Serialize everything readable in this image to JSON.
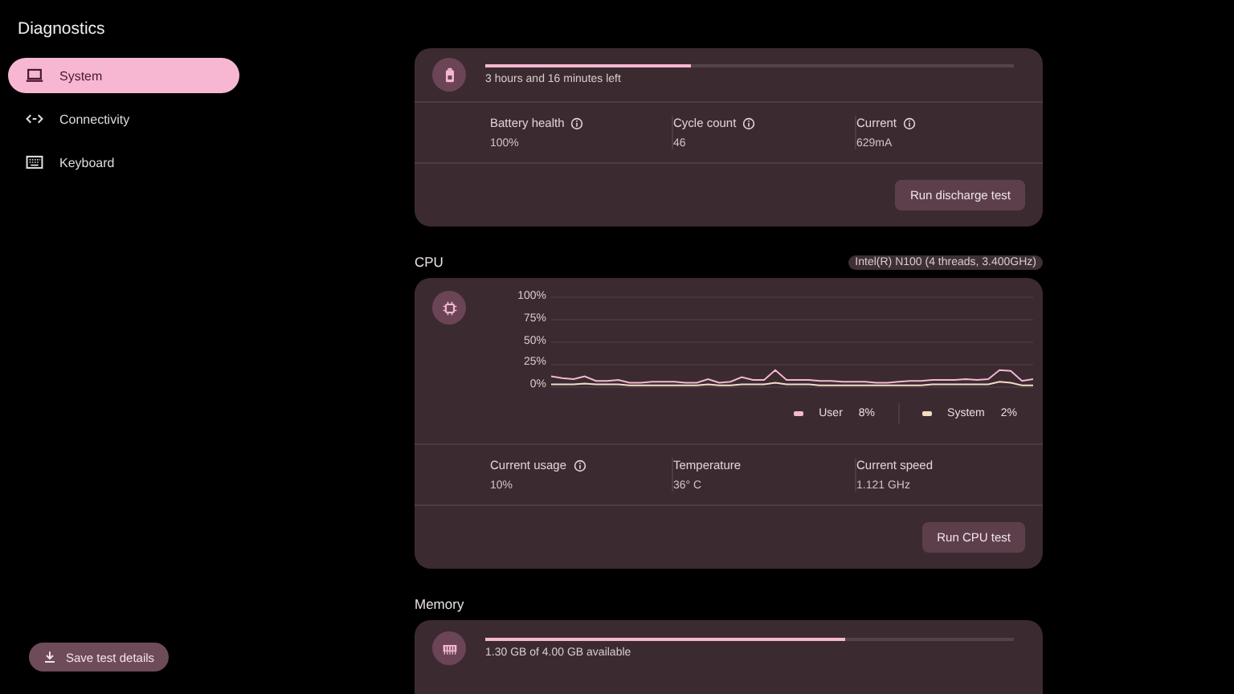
{
  "sidebar": {
    "title": "Diagnostics",
    "items": [
      {
        "label": "System",
        "selected": true
      },
      {
        "label": "Connectivity",
        "selected": false
      },
      {
        "label": "Keyboard",
        "selected": false
      }
    ],
    "save_button": "Save test details"
  },
  "battery": {
    "level": 0.39,
    "status": "3 hours and 16 minutes left",
    "stats": [
      {
        "label": "Battery health",
        "value": "100%",
        "info": true
      },
      {
        "label": "Cycle count",
        "value": "46",
        "info": true
      },
      {
        "label": "Current",
        "value": "629mA",
        "info": true
      }
    ],
    "button": "Run discharge test"
  },
  "cpu": {
    "title": "CPU",
    "chip": "Intel(R) N100 (4 threads, 3.400GHz)",
    "chart_data": {
      "type": "line",
      "grid": true,
      "ylim": [
        0,
        100
      ],
      "yticks": [
        {
          "value": 0,
          "label": "0%"
        },
        {
          "value": 25,
          "label": "25%"
        },
        {
          "value": 50,
          "label": "50%"
        },
        {
          "value": 75,
          "label": "75%"
        },
        {
          "value": 100,
          "label": "100%"
        }
      ],
      "series": [
        {
          "name": "User",
          "color": "#f5b8d0",
          "values": [
            12,
            10,
            9,
            12,
            7,
            7,
            8,
            5,
            5,
            6,
            6,
            6,
            5,
            5,
            9,
            5,
            6,
            11,
            8,
            8,
            19,
            8,
            8,
            8,
            7,
            7,
            6,
            6,
            6,
            5,
            5,
            6,
            7,
            7,
            8,
            8,
            8,
            9,
            8,
            9,
            19,
            18,
            7,
            9
          ]
        },
        {
          "name": "System",
          "color": "#f3dcc6",
          "values": [
            3,
            3,
            3,
            4,
            3,
            3,
            3,
            2,
            2,
            2,
            2,
            2,
            2,
            2,
            3,
            2,
            2,
            3,
            3,
            3,
            5,
            3,
            3,
            3,
            2,
            2,
            2,
            2,
            2,
            2,
            2,
            2,
            2,
            2,
            3,
            3,
            3,
            3,
            3,
            3,
            6,
            5,
            2,
            2
          ]
        }
      ]
    },
    "legend_values": [
      "8%",
      "2%"
    ],
    "stats": [
      {
        "label": "Current usage",
        "value": "10%",
        "info": true
      },
      {
        "label": "Temperature",
        "value": "36° C",
        "info": false
      },
      {
        "label": "Current speed",
        "value": "1.121 GHz",
        "info": false
      }
    ],
    "button": "Run CPU test"
  },
  "memory": {
    "title": "Memory",
    "level": 0.68,
    "status": "1.30 GB of 4.00 GB available"
  }
}
